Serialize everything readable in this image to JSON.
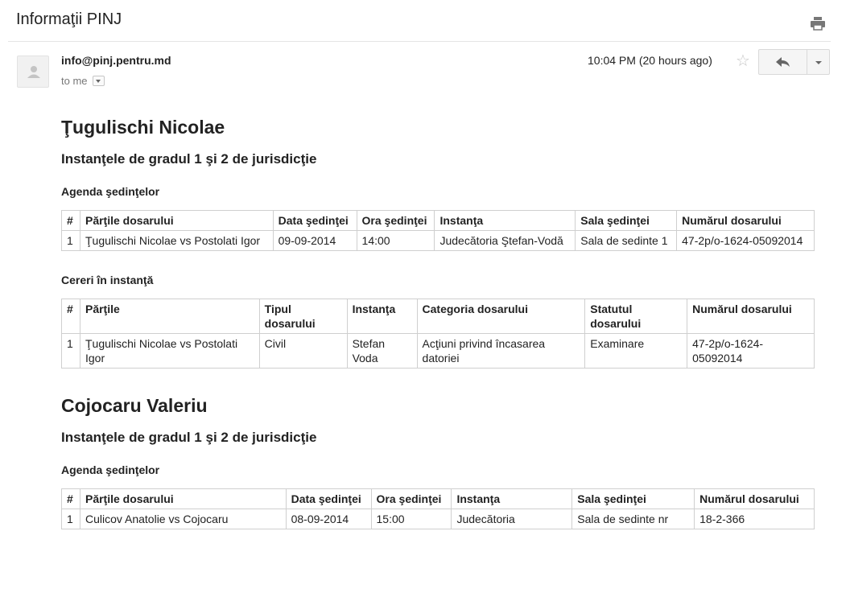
{
  "email": {
    "subject": "Informaţii PINJ",
    "sender": "info@pinj.pentru.md",
    "recipient": "to me",
    "timestamp": "10:04 PM (20 hours ago)"
  },
  "icons": {
    "print": "print-icon",
    "avatar": "default-avatar-icon",
    "star": "star-icon",
    "reply": "reply-arrow-icon",
    "more": "chevron-down-icon"
  },
  "colors": {
    "text": "#222222",
    "muted": "#777777",
    "border": "#cfcfcf",
    "button_bg": "#f5f5f5"
  },
  "persons": [
    {
      "name": "Ţugulischi Nicolae",
      "level_title": "Instanţele de gradul 1 şi 2 de jurisdicţie",
      "agenda": {
        "title": "Agenda şedinţelor",
        "headers": [
          "#",
          "Părţile dosarului",
          "Data şedinţei",
          "Ora şedinţei",
          "Instanţa",
          "Sala şedinţei",
          "Numărul dosarului"
        ],
        "rows": [
          [
            "1",
            "Ţugulischi Nicolae vs Postolati Igor",
            "09-09-2014",
            "14:00",
            "Judecătoria Ştefan-Vodă",
            "Sala de sedinte 1",
            "47-2p/o-1624-05092014"
          ]
        ]
      },
      "requests": {
        "title": "Cereri în instanţă",
        "headers": [
          "#",
          "Părţile",
          "Tipul dosarului",
          "Instanţa",
          "Categoria dosarului",
          "Statutul dosarului",
          "Numărul dosarului"
        ],
        "rows": [
          [
            "1",
            "Ţugulischi Nicolae vs Postolati Igor",
            "Civil",
            "Stefan Voda",
            "Acţiuni privind încasarea datoriei",
            "Examinare",
            "47-2p/o-1624-05092014"
          ]
        ]
      }
    },
    {
      "name": "Cojocaru Valeriu",
      "level_title": "Instanţele de gradul 1 şi 2 de jurisdicţie",
      "agenda": {
        "title": "Agenda şedinţelor",
        "headers": [
          "#",
          "Părţile dosarului",
          "Data şedinţei",
          "Ora şedinţei",
          "Instanţa",
          "Sala şedinţei",
          "Numărul dosarului"
        ],
        "rows": [
          [
            "1",
            "Culicov Anatolie vs Cojocaru",
            "08-09-2014",
            "15:00",
            "Judecătoria",
            "Sala de sedinte nr",
            "18-2-366"
          ]
        ]
      }
    }
  ]
}
